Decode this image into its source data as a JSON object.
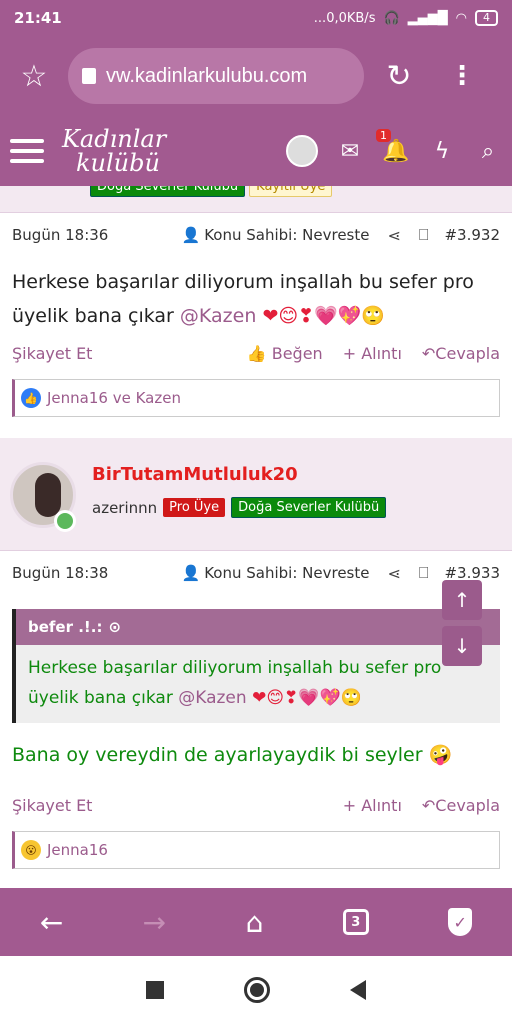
{
  "status": {
    "time": "21:41",
    "network": "...0,0KB/s",
    "battery": "4"
  },
  "browser": {
    "url": "vw.kadinlarkulubu.com"
  },
  "site": {
    "logo_line1": "Kadınlar",
    "logo_line2": "kulübü",
    "notif_count": "1"
  },
  "top_badges": {
    "green": "Doğa Severler Kulübü",
    "yellow": "Kayıtlı Üye"
  },
  "post1": {
    "time": "Bugün 18:36",
    "owner": "Konu Sahibi: Nevreste",
    "number": "#3.932",
    "text": "Herkese başarılar diliyorum inşallah bu sefer pro üyelik bana çıkar ",
    "mention": "@Kazen",
    "emoji": "❤😊❣💗💖🙄",
    "report": "Şikayet Et",
    "like": "Beğen",
    "quote": "+ Alıntı",
    "reply": "Cevapla",
    "likers": "Jenna16 ve Kazen"
  },
  "user2": {
    "name": "BirTutamMutluluk20",
    "title": "azerinnn",
    "badge_red": "Pro Üye",
    "badge_green": "Doğa Severler Kulübü"
  },
  "post2": {
    "time": "Bugün 18:38",
    "owner": "Konu Sahibi: Nevreste",
    "number": "#3.933",
    "quote_author": "befer .!.:",
    "quote_text": "Herkese başarılar diliyorum inşallah bu sefer pro üyelik bana çıkar ",
    "quote_mention": "@Kazen",
    "quote_emoji": "❤😊❣💗💖🙄",
    "text": "Bana oy vereydin de ayarlayaydik bi seyler",
    "text_emoji": "🤪",
    "report": "Şikayet Et",
    "quote": "+ Alıntı",
    "reply": "Cevapla",
    "likers": "Jenna16"
  }
}
